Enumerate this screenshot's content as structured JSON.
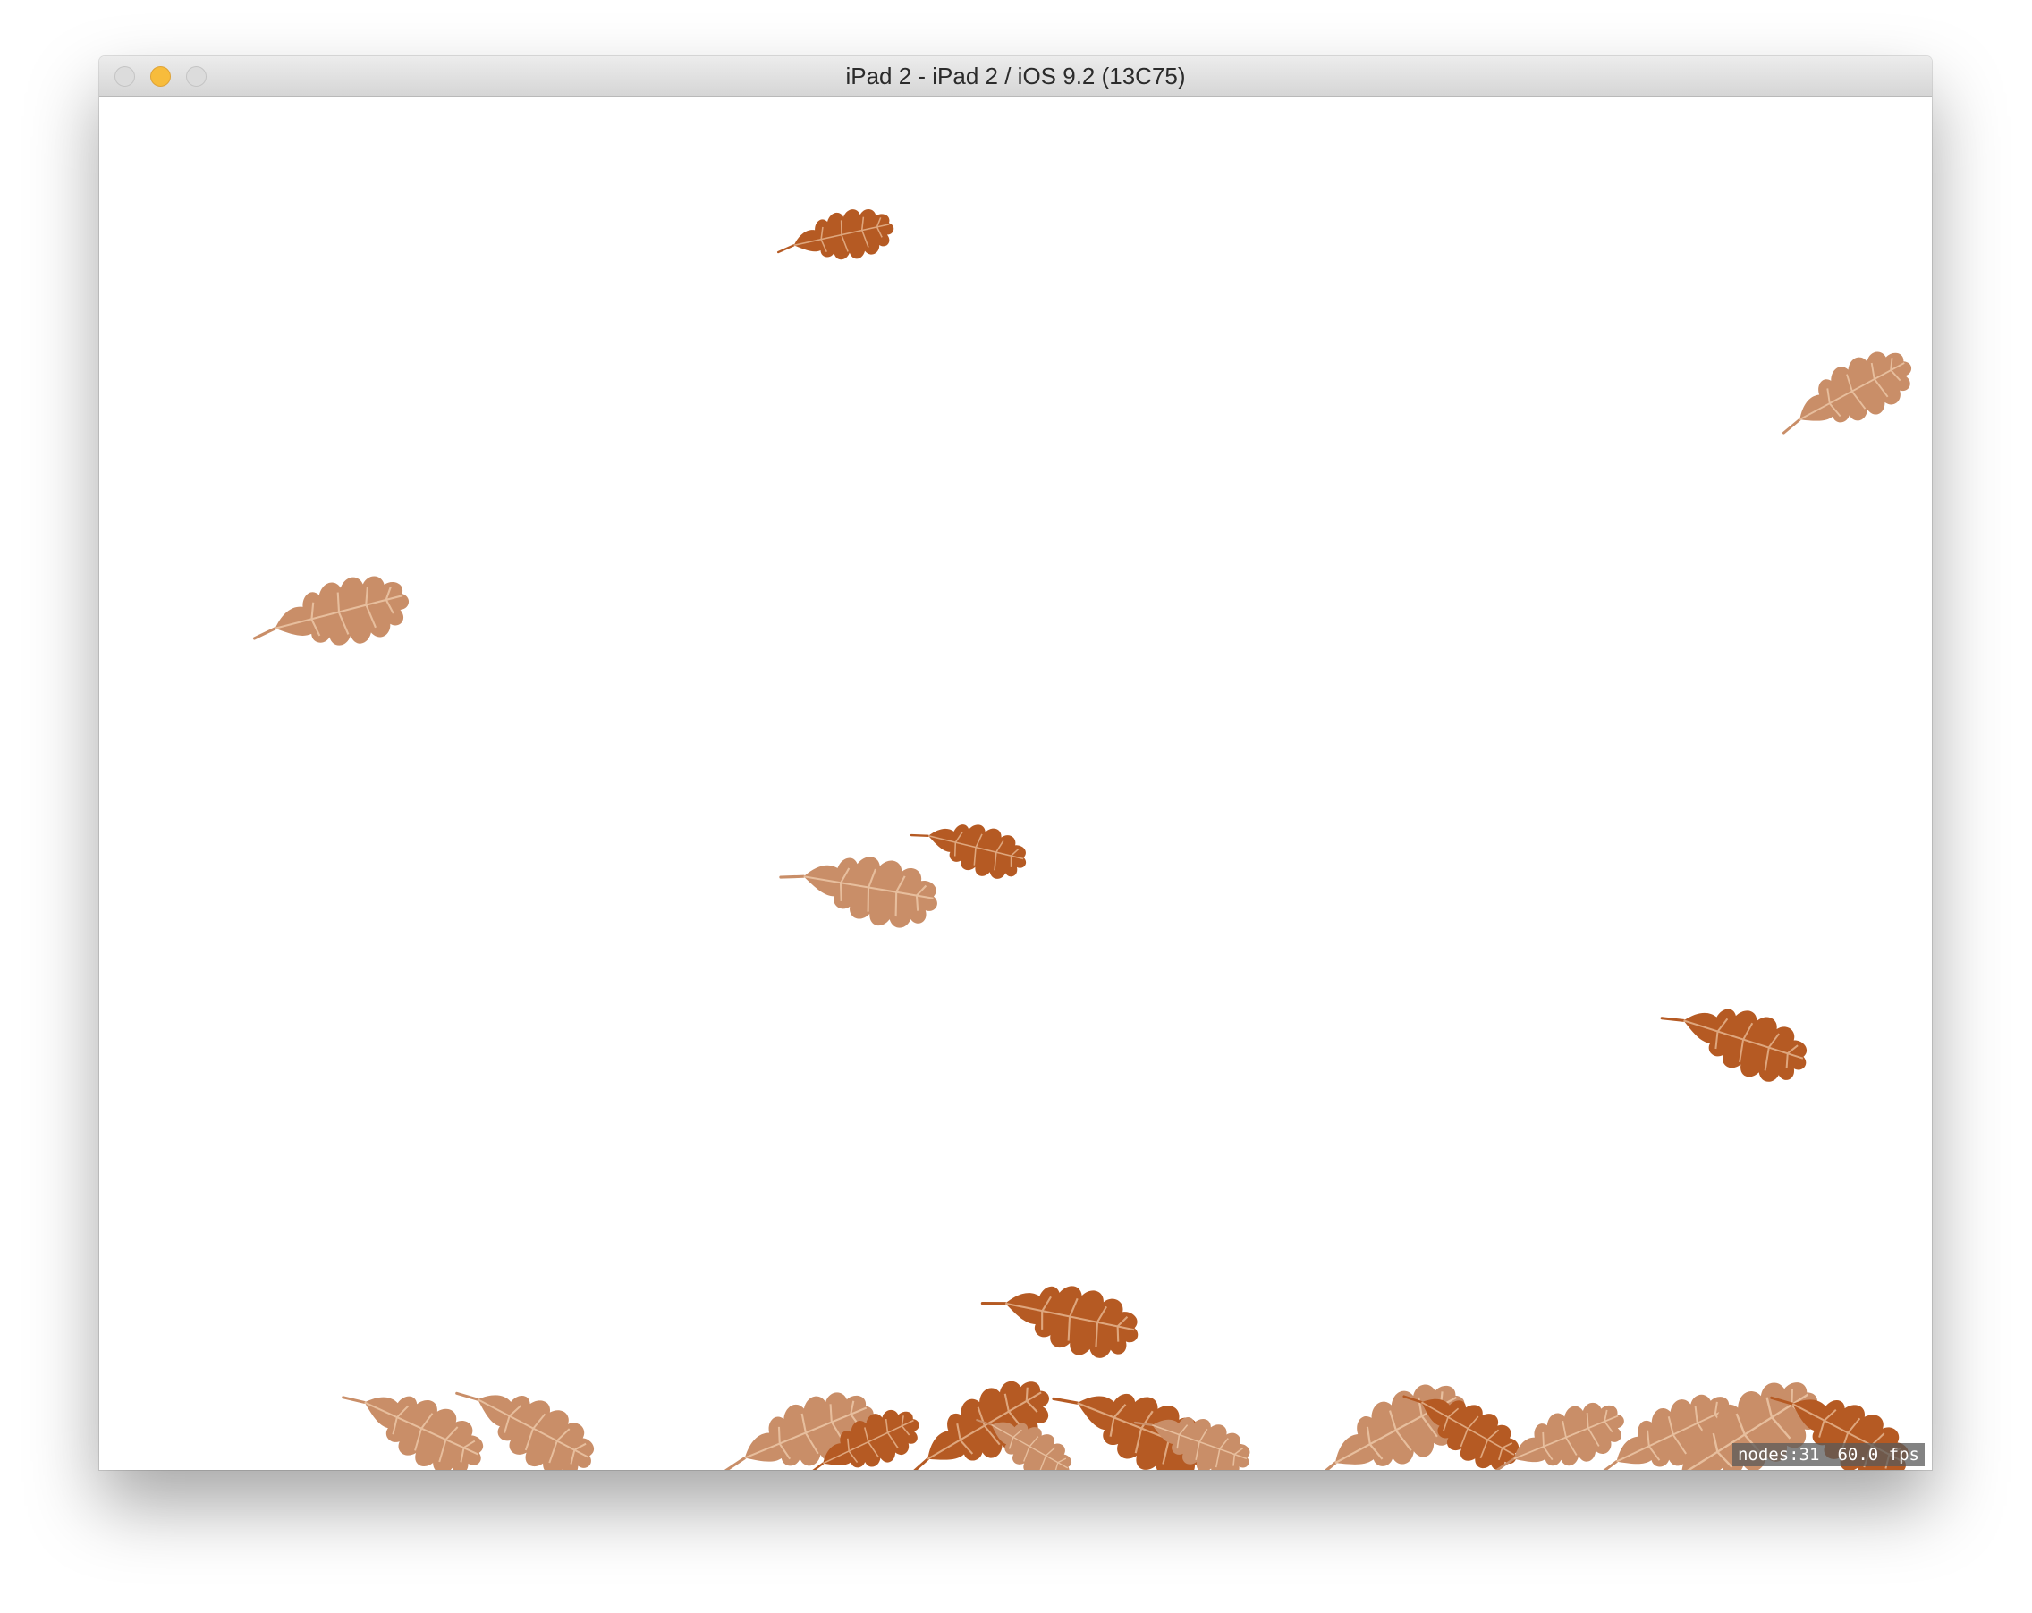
{
  "window": {
    "title": "iPad 2 - iPad 2 / iOS 9.2 (13C75)"
  },
  "scene": {
    "background_color": "#ffffff",
    "leaf_colors": {
      "dark": "#b55a23",
      "light": "#c98e68"
    },
    "stats": {
      "nodes": "nodes:31",
      "fps": "60.0 fps"
    }
  }
}
